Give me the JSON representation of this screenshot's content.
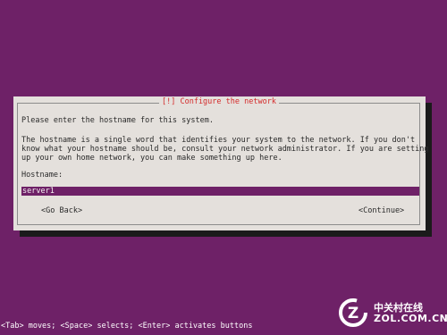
{
  "dialog": {
    "title": "[!] Configure the network",
    "intro": "Please enter the hostname for this system.",
    "description_line1": "The hostname is a single word that identifies your system to the network. If you don't",
    "description_line2": "know what your hostname should be, consult your network administrator. If you are setting",
    "description_line3": "up your own home network, you can make something up here.",
    "hostname_label": "Hostname:",
    "hostname_value": "server1",
    "go_back_label": "<Go Back>",
    "continue_label": "<Continue>"
  },
  "status_bar": {
    "hint": "<Tab> moves; <Space> selects; <Enter> activates buttons"
  },
  "watermark": {
    "chinese": "中关村在线",
    "url": "ZOL.COM.CN",
    "logo_letter": "Z"
  },
  "colors": {
    "background": "#6e2167",
    "dialog": "#e4e0dc",
    "title": "#d42b2b",
    "input_bg": "#6e2167"
  }
}
